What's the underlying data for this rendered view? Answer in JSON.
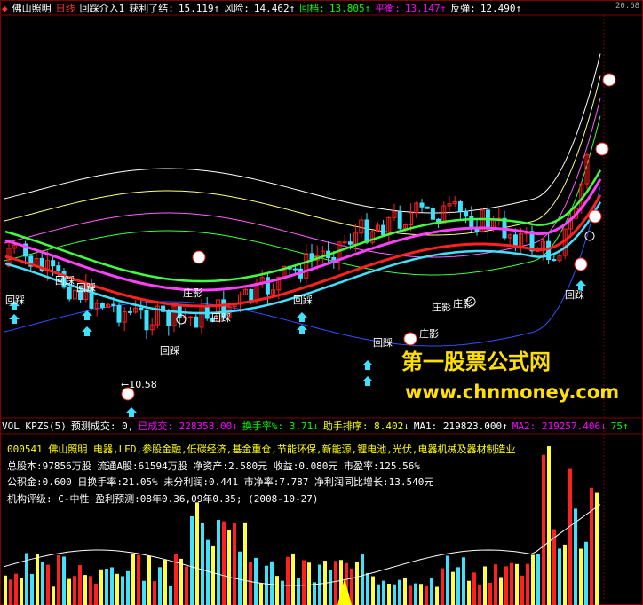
{
  "price_header": {
    "name": "佛山照明",
    "period": "日线",
    "items": [
      {
        "label": "回踩介入1",
        "value": "",
        "color": "#ffffff"
      },
      {
        "label": "获利了结:",
        "value": "15.119↑",
        "color": "#ffffff"
      },
      {
        "label": "风险:",
        "value": "14.462↑",
        "color": "#ffffff"
      },
      {
        "label": "回档:",
        "value": "13.805↑",
        "color": "#00ff00"
      },
      {
        "label": "平衡:",
        "value": "13.147↑",
        "color": "#ff00ff"
      },
      {
        "label": "反弹:",
        "value": "12.490↑",
        "color": "#ffffff"
      }
    ],
    "edge_value": "20.68"
  },
  "volume_header": {
    "items": [
      {
        "text": "VOL KPZS(5)",
        "color": "#ffffff"
      },
      {
        "text": "预测成交: 0,",
        "color": "#ffffff"
      },
      {
        "text": "已成交: 228358.00↓",
        "color": "#ff00ff"
      },
      {
        "text": "换手率%: 3.71↓",
        "color": "#00ff00"
      },
      {
        "text": "助手排序: 8.402↓",
        "color": "#ffff00"
      },
      {
        "text": "MA1: 219823.000↑",
        "color": "#ffffff"
      },
      {
        "text": "MA2: 219257.406↓",
        "color": "#ff00ff"
      },
      {
        "text": "75↑",
        "color": "#00ff00"
      }
    ]
  },
  "stock_info": {
    "line1": "000541 佛山照明 电器,LED,参股金融,低碳经济,基金重仓,节能环保,新能源,锂电池,光伏,电器机械及器材制造业",
    "line2": "总股本:97856万股 流通A股:61594万股  净资产:2.580元  收益:0.080元  市盈率:125.56%",
    "line3": "公积金:0.600  日换手率:21.05%  未分利润:0.441  市净率:7.787  净利润同比增长:13.540元",
    "line4": "机构评级: C-中性 盈利预测:08年0.36,09年0.35; (2008-10-27)"
  },
  "annotations": {
    "huicai": "回踩",
    "zhuangying": "庄影",
    "low_price": "10.58"
  },
  "watermark": {
    "title": "第一股票公式网",
    "url": "www.chnmoney.com"
  },
  "colors": {
    "background": "#000000",
    "up_candle": "#ff2020",
    "down_candle": "#40e0ff",
    "accent_yellow": "#ffff00"
  }
}
